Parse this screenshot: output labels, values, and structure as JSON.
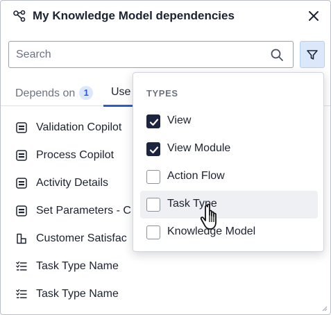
{
  "header": {
    "title": "My Knowledge Model dependencies",
    "icon": "dependencies-icon",
    "close_icon": "close-icon"
  },
  "search": {
    "placeholder": "Search",
    "value": "",
    "icon": "search-icon"
  },
  "filter": {
    "icon": "filter-icon",
    "active": true
  },
  "tabs": [
    {
      "label": "Depends on",
      "count": "1",
      "active": false
    },
    {
      "label": "Use",
      "active": true
    }
  ],
  "items": [
    {
      "label": "Validation Copilot",
      "icon": "form-icon"
    },
    {
      "label": "Process Copilot",
      "icon": "form-icon"
    },
    {
      "label": "Activity Details",
      "icon": "form-icon"
    },
    {
      "label": "Set Parameters - C",
      "icon": "form-icon"
    },
    {
      "label": "Customer Satisfac",
      "icon": "layout-icon"
    },
    {
      "label": "Task Type Name",
      "icon": "checklist-icon"
    },
    {
      "label": "Task Type Name",
      "icon": "checklist-icon"
    }
  ],
  "dropdown": {
    "heading": "TYPES",
    "options": [
      {
        "label": "View",
        "checked": true
      },
      {
        "label": "View Module",
        "checked": true
      },
      {
        "label": "Action Flow",
        "checked": false
      },
      {
        "label": "Task Type",
        "checked": false,
        "hovered": true
      },
      {
        "label": "Knowledge Model",
        "checked": false
      }
    ]
  },
  "colors": {
    "accent": "#2a5bd7",
    "checkbox_checked": "#1b2440",
    "filter_active_bg": "#dbe8fb"
  }
}
